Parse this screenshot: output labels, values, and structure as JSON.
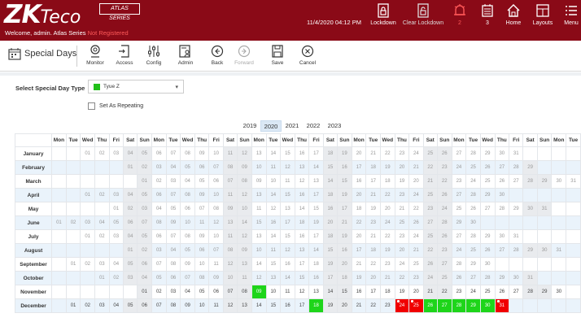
{
  "header": {
    "logo_main": "ZK",
    "logo_eco": "Teco",
    "atlas_badge": "ATLAS SERIES",
    "welcome_text": "Welcome, admin.  Atlas Series",
    "not_registered": "Not Registered",
    "datetime": "11/4/2020 04:12 PM",
    "buttons": [
      {
        "label": "Lockdown"
      },
      {
        "label": "Clear Lockdown"
      },
      {
        "label": "2"
      },
      {
        "label": "3"
      },
      {
        "label": "Home"
      },
      {
        "label": "Layouts"
      },
      {
        "label": "Menu"
      }
    ]
  },
  "toolbar": {
    "page_title": "Special Days",
    "tools": [
      {
        "label": "Monitor"
      },
      {
        "label": "Access"
      },
      {
        "label": "Config"
      },
      {
        "label": "Admin"
      },
      {
        "label": "Back"
      },
      {
        "label": "Forward"
      },
      {
        "label": "Save"
      },
      {
        "label": "Cancel"
      }
    ]
  },
  "form": {
    "select_label": "Select Special Day Type",
    "selected_type": "Tyue Z",
    "swatch_color": "#22c01a",
    "repeating_label": "Set As Repeating",
    "repeating_checked": false
  },
  "years": [
    "2019",
    "2020",
    "2021",
    "2022",
    "2023"
  ],
  "active_year": "2020",
  "calendar": {
    "weekday_headers": [
      "Mon",
      "Tue",
      "Wed",
      "Thu",
      "Fri",
      "Sat",
      "Sun",
      "Mon",
      "Tue",
      "Wed",
      "Thu",
      "Fri",
      "Sat",
      "Sun",
      "Mon",
      "Tue",
      "Wed",
      "Thu",
      "Fri",
      "Sat",
      "Sun",
      "Mon",
      "Tue",
      "Wed",
      "Thu",
      "Fri",
      "Sat",
      "Sun",
      "Mon",
      "Tue",
      "Wed",
      "Thu",
      "Fri",
      "Sat",
      "Sun",
      "Mon",
      "Tue"
    ],
    "months": [
      {
        "name": "January",
        "offset": 2,
        "days": 31
      },
      {
        "name": "February",
        "offset": 5,
        "days": 29
      },
      {
        "name": "March",
        "offset": 6,
        "days": 31
      },
      {
        "name": "April",
        "offset": 2,
        "days": 30
      },
      {
        "name": "May",
        "offset": 4,
        "days": 31
      },
      {
        "name": "June",
        "offset": 0,
        "days": 30
      },
      {
        "name": "July",
        "offset": 2,
        "days": 31
      },
      {
        "name": "August",
        "offset": 5,
        "days": 31
      },
      {
        "name": "September",
        "offset": 1,
        "days": 30
      },
      {
        "name": "October",
        "offset": 3,
        "days": 31
      },
      {
        "name": "November",
        "offset": 6,
        "days": 30
      },
      {
        "name": "December",
        "offset": 1,
        "days": 31
      }
    ],
    "highlights": [
      {
        "month": "November",
        "day": 9,
        "color": "green"
      },
      {
        "month": "December",
        "day": 18,
        "color": "green"
      },
      {
        "month": "December",
        "day": 24,
        "color": "red",
        "flag": true
      },
      {
        "month": "December",
        "day": 25,
        "color": "red",
        "flag": true
      },
      {
        "month": "December",
        "day": 26,
        "color": "green"
      },
      {
        "month": "December",
        "day": 27,
        "color": "green"
      },
      {
        "month": "December",
        "day": 28,
        "color": "green"
      },
      {
        "month": "December",
        "day": 29,
        "color": "green"
      },
      {
        "month": "December",
        "day": 30,
        "color": "green"
      },
      {
        "month": "December",
        "day": 31,
        "color": "red",
        "flag": true
      }
    ],
    "active_month_from": "November",
    "colors": {
      "green": "#1ed51a",
      "red": "#f00000",
      "brand": "#8a0a17"
    }
  }
}
